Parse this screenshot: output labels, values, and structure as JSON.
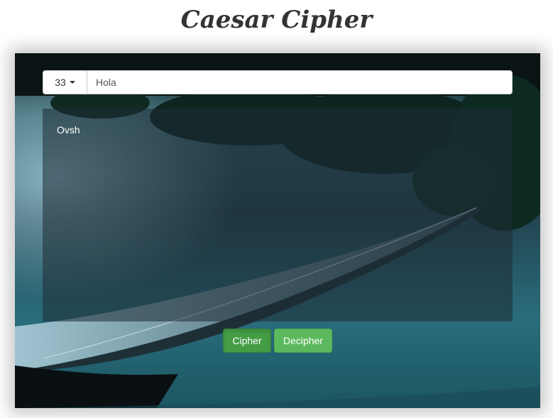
{
  "header": {
    "title": "Caesar Cipher"
  },
  "controls": {
    "shift_value": "33",
    "input_value": "Hola"
  },
  "output": {
    "text": "Ovsh"
  },
  "buttons": {
    "cipher_label": "Cipher",
    "decipher_label": "Decipher"
  },
  "colors": {
    "cipher_button": "#449d44",
    "decipher_button": "#5cb85c",
    "title_text": "#333333"
  },
  "icons": {
    "dropdown": "caret-down-icon"
  }
}
